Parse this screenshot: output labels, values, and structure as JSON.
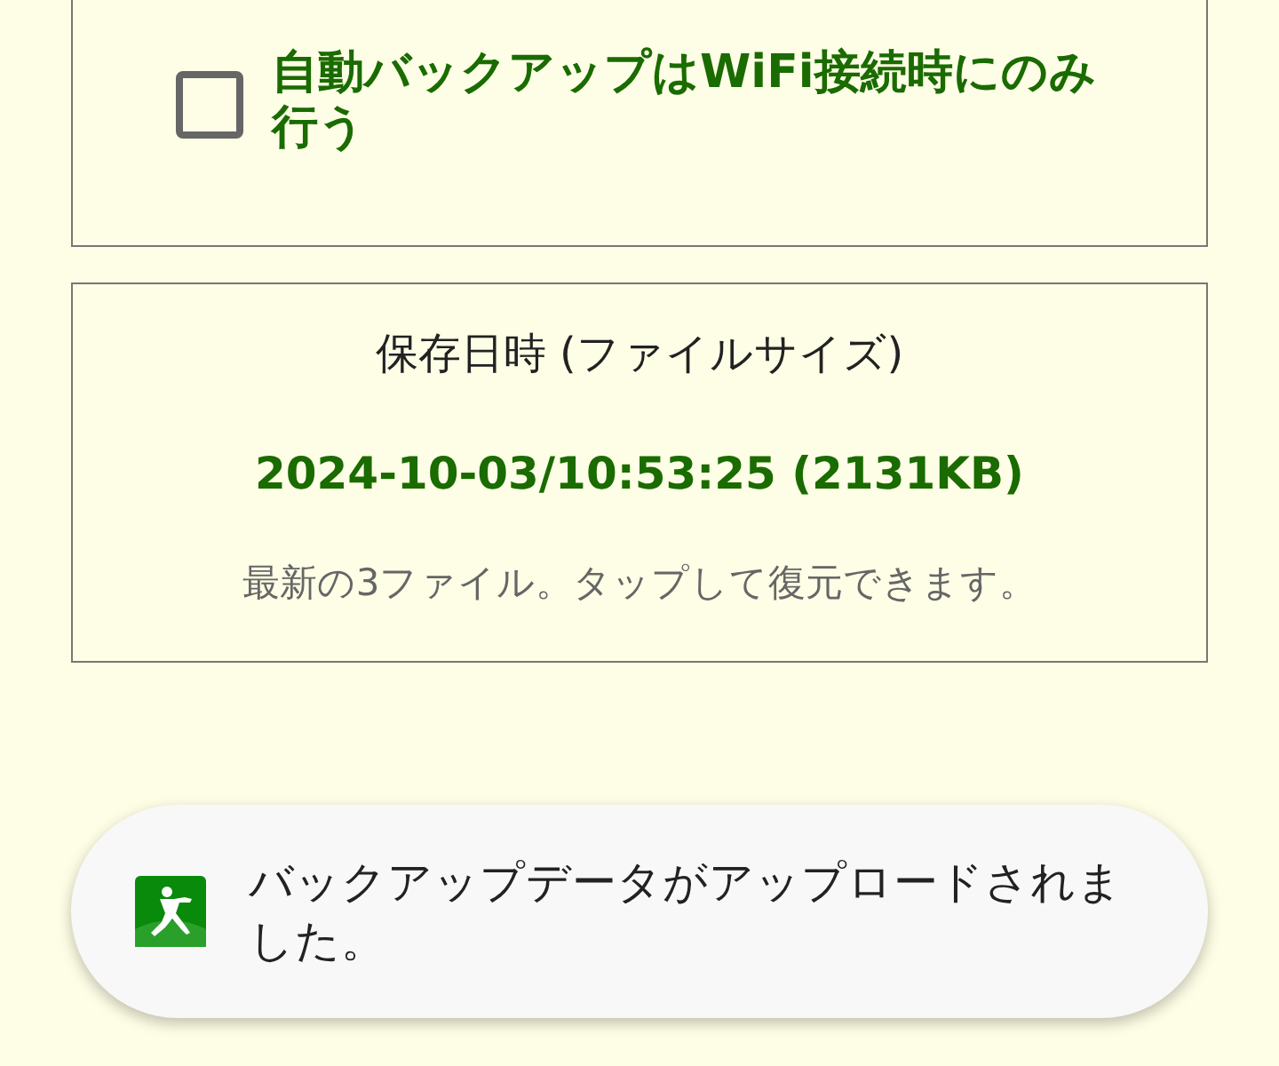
{
  "settings_card": {
    "checkbox": {
      "label": "自動バックアップはWiFi接続時にのみ行う",
      "checked": false
    }
  },
  "backup_card": {
    "heading": "保存日時 (ファイルサイズ)",
    "files": [
      "2024-10-03/10:53:25 (2131KB)"
    ],
    "note": "最新の3ファイル。タップして復元できます。"
  },
  "toast": {
    "message": "バックアップデータがアップロードされました。"
  }
}
